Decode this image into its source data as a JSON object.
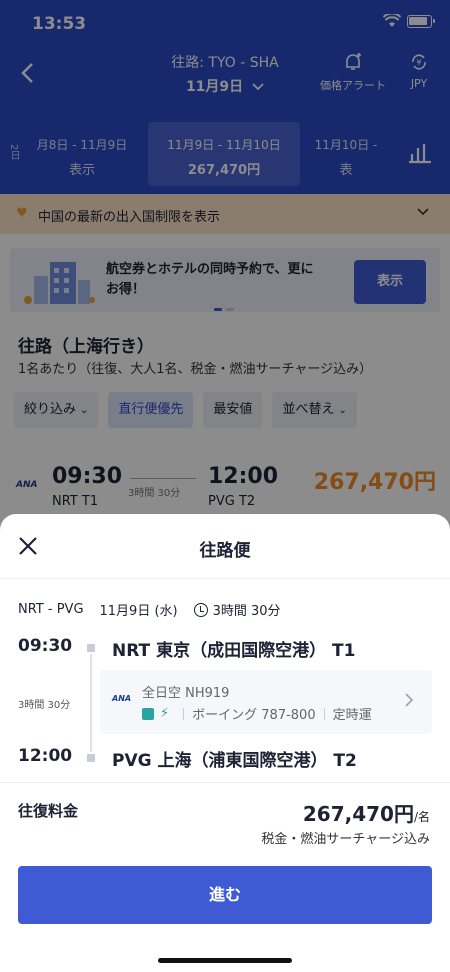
{
  "status_bar": {
    "time": "13:53"
  },
  "header": {
    "route_title": "往路: TYO - SHA",
    "route_date": "11月9日",
    "price_alert_label": "価格アラート",
    "currency_label": "JPY",
    "side_label": "2日",
    "dates": [
      {
        "range": "月8日 - 11月9日",
        "value": "表示"
      },
      {
        "range": "11月9日 - 11月10日",
        "value": "267,470円"
      },
      {
        "range": "11月10日 -",
        "value": "表"
      }
    ]
  },
  "notice": {
    "text": "中国の最新の出入国制限を表示"
  },
  "promo": {
    "text_line1": "航空券とホテルの同時予約で、更に",
    "text_line2": "お得！",
    "button": "表示"
  },
  "section": {
    "title": "往路（上海行き）",
    "subtitle": "1名あたり（往復、大人1名、税金・燃油サーチャージ込み）"
  },
  "filters": [
    "絞り込み",
    "直行便優先",
    "最安値",
    "並べ替え"
  ],
  "flight_card": {
    "airline": "ANA",
    "dep_time": "09:30",
    "dep_airport": "NRT T1",
    "duration": "3時間 30分",
    "arr_time": "12:00",
    "arr_airport": "PVG T2",
    "price": "267,470円"
  },
  "sheet": {
    "title": "往路便",
    "route": "NRT - PVG",
    "date": "11月9日 (水)",
    "duration": "3時間 30分",
    "dep_time": "09:30",
    "dep_airport": "NRT  東京（成田国際空港） T1",
    "segment_duration": "3時間 30分",
    "airline_logo": "ANA",
    "airline_flight": "全日空  NH919",
    "aircraft": "ボーイング 787-800",
    "punctuality": "定時運",
    "arr_time": "12:00",
    "arr_airport": "PVG  上海（浦東国際空港） T2",
    "fare_label": "往復料金",
    "fare_price": "267,470円",
    "fare_unit": "/名",
    "fare_note": "税金・燃油サーチャージ込み",
    "proceed_button": "進む"
  }
}
